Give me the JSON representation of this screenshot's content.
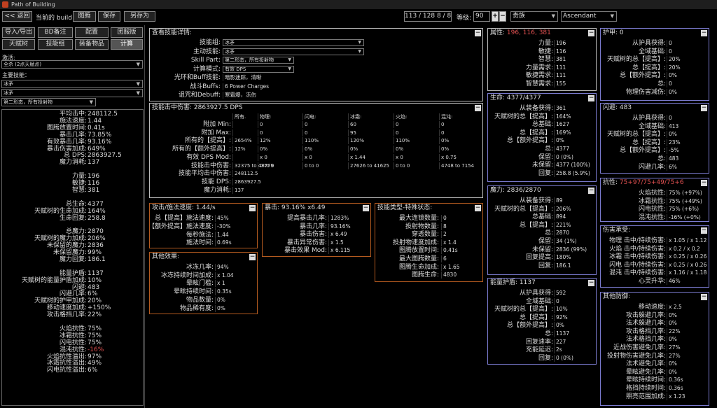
{
  "window": {
    "title": "Path of Building"
  },
  "topbar": {
    "back": "<< 返回",
    "build_label": "当前的 build：",
    "build_name": "图腾",
    "save": "保存",
    "save_as": "另存为",
    "points": "113 / 128   8 / 8",
    "level_label": "等级:",
    "level": "90",
    "plus": "+",
    "minus": "−",
    "class": "贵族",
    "ascendancy": "Ascendant"
  },
  "tabs": {
    "import_export": "导入/导出",
    "notes": "BD备注",
    "config": "配置",
    "skill_tree": "天赋树",
    "skills": "技能组",
    "items": "装备物品",
    "calcs": "计算",
    "party": "团服版"
  },
  "sidebar": {
    "socket_label": "激活:",
    "socket_value": "全杀 (2点天赋点)",
    "main_skill_label": "主要技能：",
    "main_skill": "冰矛",
    "main_skill_part": "冰矛",
    "skill_part": "第二形态，所有投射物"
  },
  "side_stats": [
    {
      "k": "平均击中:",
      "v": "248112.5"
    },
    {
      "k": "施法速度:",
      "v": "1.44"
    },
    {
      "k": "图腾放置时间:",
      "v": "0.41s"
    },
    {
      "k": "暴击几率:",
      "v": "73.85%"
    },
    {
      "k": "有效暴击几率:",
      "v": "93.16%"
    },
    {
      "k": "暴击伤害加成:",
      "v": "649%"
    },
    {
      "k": "总 DPS:",
      "v": "2863927.5"
    },
    {
      "k": "魔力消耗:",
      "v": "137"
    },
    {
      "k": "",
      "v": ""
    },
    {
      "k": "力量:",
      "v": "196"
    },
    {
      "k": "敏捷:",
      "v": "116"
    },
    {
      "k": "智慧:",
      "v": "381"
    },
    {
      "k": "",
      "v": ""
    },
    {
      "k": "总生命:",
      "v": "4377"
    },
    {
      "k": "天赋树的生命加成:",
      "v": "164%"
    },
    {
      "k": "生命回复:",
      "v": "258.8"
    },
    {
      "k": "",
      "v": ""
    },
    {
      "k": "总魔力:",
      "v": "2870"
    },
    {
      "k": "天赋树的魔力加成:",
      "v": "206%"
    },
    {
      "k": "未保留的魔力:",
      "v": "2836"
    },
    {
      "k": "未保留魔力:",
      "v": "99%"
    },
    {
      "k": "魔力回复:",
      "v": "186.1"
    },
    {
      "k": "",
      "v": ""
    },
    {
      "k": "能量护盾:",
      "v": "1137"
    },
    {
      "k": "天赋树的能量护盾加成:",
      "v": "10%"
    },
    {
      "k": "闪避:",
      "v": "483"
    },
    {
      "k": "闪避几率:",
      "v": "6%"
    },
    {
      "k": "天赋树的护甲加成:",
      "v": "20%"
    },
    {
      "k": "移动速度加成:",
      "v": "+150%"
    },
    {
      "k": "攻击格挡几率:",
      "v": "22%"
    },
    {
      "k": "",
      "v": ""
    },
    {
      "k": "火焰抗性:",
      "v": "75%"
    },
    {
      "k": "冰霜抗性:",
      "v": "75%"
    },
    {
      "k": "闪电抗性:",
      "v": "75%"
    },
    {
      "k": "混沌抗性:",
      "v": "-16%",
      "red": true
    },
    {
      "k": "火焰抗性溢出:",
      "v": "97%"
    },
    {
      "k": "冰霜抗性溢出:",
      "v": "49%"
    },
    {
      "k": "闪电抗性溢出:",
      "v": "6%"
    }
  ],
  "skill_view": {
    "title": "查看技能详情:",
    "rows": [
      {
        "k": "技能组:",
        "v": "冰矛",
        "sel": true
      },
      {
        "k": "主动技能:",
        "v": "冰矛",
        "sel": true
      },
      {
        "k": "Skill Part:",
        "v": "第二形态，所有投射物",
        "sel": true
      },
      {
        "k": "计算模式:",
        "v": "有效 DPS",
        "sel": true
      },
      {
        "k": "光环和Buff技能:",
        "v": "暗影迷踪，清晰"
      },
      {
        "k": "战斗Buffs:",
        "v": "6 Power Charges"
      },
      {
        "k": "诅咒和Debuff:",
        "v": "寒霜爆，冻伤"
      }
    ]
  },
  "hit_damage": {
    "title": "技能击中伤害: 2863927.5 DPS",
    "headers": [
      "所有.",
      "物理:",
      "闪电:",
      "冰霜:",
      "火焰:",
      "混沌:"
    ],
    "rows": [
      {
        "k": "附加 Min:",
        "c": [
          "",
          "0",
          "0",
          "60",
          "0",
          "0"
        ]
      },
      {
        "k": "附加 Max:",
        "c": [
          "",
          "0",
          "0",
          "95",
          "0",
          "0"
        ]
      },
      {
        "k": "所有的【提高】:",
        "c": [
          "2654%",
          "12%",
          "110%",
          "120%",
          "110%",
          "0%"
        ]
      },
      {
        "k": "所有的【额外提高】:",
        "c": [
          "12%",
          "0%",
          "0%",
          "0%",
          "0%",
          "0%"
        ]
      },
      {
        "k": "有效 DPS Mod:",
        "c": [
          "",
          "x 0",
          "x 0",
          "x 1.44",
          "x 0",
          "x 0.75"
        ]
      },
      {
        "k": "技能击中伤害:",
        "c": [
          "32375 to 48779",
          "0 to 0",
          "0 to 0",
          "27626 to 41625",
          "0 to 0",
          "4748 to 7154"
        ]
      },
      {
        "k": "技能平均击中伤害:",
        "c": [
          "248112.5"
        ]
      },
      {
        "k": "技能 DPS:",
        "c": [
          "2863927.5"
        ]
      },
      {
        "k": "魔力消耗:",
        "c": [
          "137"
        ]
      }
    ]
  },
  "attack_speed": {
    "title": "攻击/施法速度: 1.44/s",
    "rows": [
      {
        "k": "总【提高】施法速度:",
        "v": "45%"
      },
      {
        "k": "【额外提高】施法速度:",
        "v": "-30%"
      },
      {
        "k": "每秒施法:",
        "v": "1.44"
      },
      {
        "k": "施法时间:",
        "v": "0.69s"
      }
    ]
  },
  "crit": {
    "title": "暴击: 93.16% x6.49",
    "rows": [
      {
        "k": "提高暴击几率:",
        "v": "1283%"
      },
      {
        "k": "暴击几率:",
        "v": "93.16%"
      },
      {
        "k": "暴击伤害:",
        "v": "x 6.49"
      },
      {
        "k": "暴击异常伤害:",
        "v": "x 1.5"
      },
      {
        "k": "暴击效果 Mod:",
        "v": "x 6.115"
      }
    ]
  },
  "skill_type": {
    "title": "技能类型-特殊状态:",
    "rows": [
      {
        "k": "最大连锁数量:",
        "v": "0"
      },
      {
        "k": "投射物数量:",
        "v": "8"
      },
      {
        "k": "穿透数量:",
        "v": "2"
      },
      {
        "k": "投射物速度加成:",
        "v": "x 1.4"
      },
      {
        "k": "图腾放置时间:",
        "v": "0.41s"
      },
      {
        "k": "最大图腾数量:",
        "v": "6"
      },
      {
        "k": "图腾生命加成:",
        "v": "x 1.65"
      },
      {
        "k": "图腾生命:",
        "v": "4830"
      }
    ]
  },
  "other_effects": {
    "title": "其他效果:",
    "rows": [
      {
        "k": "冰冻几率:",
        "v": "94%"
      },
      {
        "k": "冰冻持续时间加成:",
        "v": "x 1.04"
      },
      {
        "k": "晕眩门槛:",
        "v": "x 1"
      },
      {
        "k": "晕眩持续时间:",
        "v": "0.35s"
      },
      {
        "k": "物品数量:",
        "v": "0%"
      },
      {
        "k": "物品稀有度:",
        "v": "0%"
      }
    ]
  },
  "attributes": {
    "title": "属性: ",
    "title_val": "196, 116, 381",
    "rows": [
      {
        "k": "力量:",
        "v": "196"
      },
      {
        "k": "敏捷:",
        "v": "116"
      },
      {
        "k": "智慧:",
        "v": "381"
      },
      {
        "k": "力量需求:",
        "v": "111"
      },
      {
        "k": "敏捷需求:",
        "v": "111"
      },
      {
        "k": "智慧需求:",
        "v": "155"
      }
    ]
  },
  "life": {
    "title": "生命: 4377/4377",
    "rows": [
      {
        "k": "从装备获得:",
        "v": "361"
      },
      {
        "k": "天赋树的总【提高】:",
        "v": "164%"
      },
      {
        "k": "总基础:",
        "v": "1627"
      },
      {
        "k": "总【提高】:",
        "v": "169%"
      },
      {
        "k": "总【额外提高】:",
        "v": "0%"
      },
      {
        "k": "总:",
        "v": "4377"
      },
      {
        "k": "保留:",
        "v": "0 (0%)"
      },
      {
        "k": "未保留:",
        "v": "4377 (100%)"
      },
      {
        "k": "回复:",
        "v": "258.8 (5.9%)"
      }
    ]
  },
  "mana": {
    "title": "魔力: 2836/2870",
    "rows": [
      {
        "k": "从装备获得:",
        "v": "89"
      },
      {
        "k": "天赋树的总【提高】:",
        "v": "206%"
      },
      {
        "k": "总基础:",
        "v": "894"
      },
      {
        "k": "总【提高】:",
        "v": "221%"
      },
      {
        "k": "总:",
        "v": "2870"
      },
      {
        "k": "保留:",
        "v": "34 (1%)"
      },
      {
        "k": "未保留:",
        "v": "2836 (99%)"
      },
      {
        "k": "回复提高:",
        "v": "180%"
      },
      {
        "k": "回复:",
        "v": "186.1"
      }
    ]
  },
  "energy_shield": {
    "title": "能量护盾: 1137",
    "rows": [
      {
        "k": "从护具获得:",
        "v": "592"
      },
      {
        "k": "全域基础:",
        "v": "0"
      },
      {
        "k": "天赋树的总【提高】:",
        "v": "10%"
      },
      {
        "k": "总【提高】:",
        "v": "92%"
      },
      {
        "k": "总【额外提高】:",
        "v": "0%"
      },
      {
        "k": "总:",
        "v": "1137"
      },
      {
        "k": "回复速率:",
        "v": "227"
      },
      {
        "k": "充能延迟:",
        "v": "2s"
      },
      {
        "k": "回复:",
        "v": "0 (0%)"
      }
    ]
  },
  "armour": {
    "title": "护甲: 0",
    "rows": [
      {
        "k": "从护具获得:",
        "v": "0"
      },
      {
        "k": "全域基础:",
        "v": "0"
      },
      {
        "k": "天赋树的总【提高】:",
        "v": "20%"
      },
      {
        "k": "总【提高】:",
        "v": "20%"
      },
      {
        "k": "总【额外提高】:",
        "v": "0%"
      },
      {
        "k": "总:",
        "v": "0"
      },
      {
        "k": "物理伤害减伤:",
        "v": "0%"
      }
    ]
  },
  "evasion": {
    "title": "闪避: 483",
    "rows": [
      {
        "k": "从护具获得:",
        "v": "0"
      },
      {
        "k": "全域基础:",
        "v": "413"
      },
      {
        "k": "天赋树的总【提高】:",
        "v": "0%"
      },
      {
        "k": "总【提高】:",
        "v": "23%"
      },
      {
        "k": "总【额外提高】:",
        "v": "-5%"
      },
      {
        "k": "总:",
        "v": "483"
      },
      {
        "k": "闪避几率:",
        "v": "6%"
      }
    ]
  },
  "resist": {
    "title": "抗性: ",
    "title_val": "75+97/75+49/75+6",
    "rows": [
      {
        "k": "火焰抗性:",
        "v": "75% (+97%)"
      },
      {
        "k": "冰霜抗性:",
        "v": "75% (+49%)"
      },
      {
        "k": "闪电抗性:",
        "v": "75% (+6%)"
      },
      {
        "k": "混沌抗性:",
        "v": "-16% (+0%)"
      }
    ]
  },
  "damage_taken": {
    "title": "伤害承受:",
    "rows": [
      {
        "k": "物理 击中/持续伤害:",
        "v": "x 1.05 / x 1.12"
      },
      {
        "k": "火焰 击中/持续伤害:",
        "v": "x 0.2 / x 0.2"
      },
      {
        "k": "冰霜 击中/持续伤害:",
        "v": "x 0.25 / x 0.26"
      },
      {
        "k": "闪电 击中/持续伤害:",
        "v": "x 0.25 / x 0.26"
      },
      {
        "k": "混沌 击中/持续伤害:",
        "v": "x 1.16 / x 1.18"
      },
      {
        "k": "心灵升华:",
        "v": "46%"
      }
    ]
  },
  "other_def": {
    "title": "其他防御:",
    "rows": [
      {
        "k": "移动速度:",
        "v": "x 2.5"
      },
      {
        "k": "攻击躲避几率:",
        "v": "0%"
      },
      {
        "k": "法术躲避几率:",
        "v": "0%"
      },
      {
        "k": "攻击格挡几率:",
        "v": "22%"
      },
      {
        "k": "法术格挡几率:",
        "v": "0%"
      },
      {
        "k": "近战伤害避免几率:",
        "v": "27%"
      },
      {
        "k": "投射物伤害避免几率:",
        "v": "27%"
      },
      {
        "k": "法术避免几率:",
        "v": "0%"
      },
      {
        "k": "晕眩避免几率:",
        "v": "0%"
      },
      {
        "k": "晕眩持续时间:",
        "v": "0.36s"
      },
      {
        "k": "格挡持续时间:",
        "v": "0.36s"
      },
      {
        "k": "照亮范围加成:",
        "v": "x 1.23"
      }
    ]
  }
}
